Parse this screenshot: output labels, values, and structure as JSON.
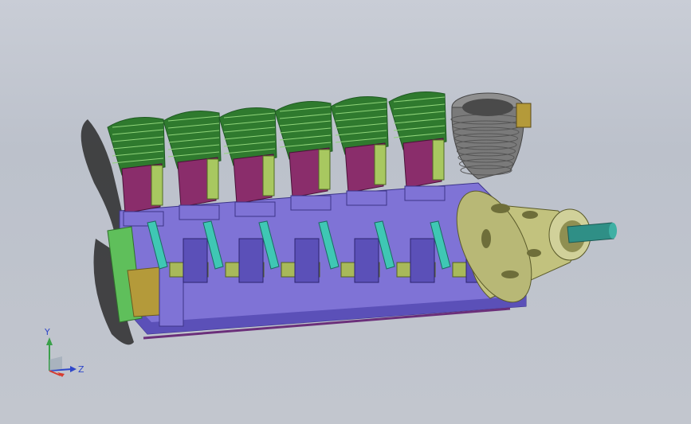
{
  "viewport": {
    "background_top": "#c9cdd6",
    "background_bottom": "#c2c6ce"
  },
  "model": {
    "description_colors": {
      "cylinder_fins": "#2f7a2e",
      "cylinder_fins_dark": "#1f5a22",
      "piston": "#8a2d6b",
      "crankcase": "#7f73d6",
      "crankcase_dark": "#5b50b8",
      "rods": "#3fc7b4",
      "yoke": "#a8b95a",
      "spinner": "#c8c88a",
      "shaft": "#2f8f86",
      "rear_cylinder": "#6f6f6f",
      "mount": "#5fbf5b",
      "gear": "#b49a3a"
    }
  },
  "triad": {
    "y_label": "Y",
    "z_label": "Z",
    "x_color": "#d63b2f",
    "y_color": "#3aa04a",
    "z_color": "#2f47c9"
  }
}
